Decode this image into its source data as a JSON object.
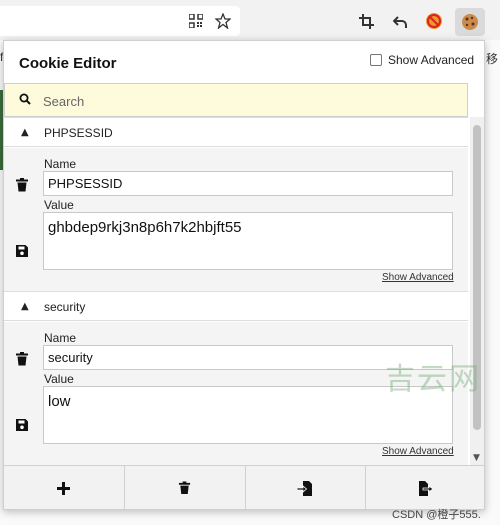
{
  "browser": {
    "icons": [
      "qr-code-icon",
      "bookmark-star-icon",
      "crop-icon",
      "undo-icon",
      "blocker-icon",
      "cookie-icon"
    ],
    "bg_left_char": "f",
    "bg_right_text": "移"
  },
  "popup": {
    "title": "Cookie Editor",
    "show_advanced_label": "Show Advanced",
    "search": {
      "placeholder": "Search"
    },
    "cookies": [
      {
        "name": "PHPSESSID",
        "name_label": "Name",
        "name_value": "PHPSESSID",
        "value_label": "Value",
        "value": "ghbdep9rkj3n8p6h7k2hbjft55",
        "show_advanced_link": "Show Advanced"
      },
      {
        "name": "security",
        "name_label": "Name",
        "name_value": "security",
        "value_label": "Value",
        "value": "low",
        "show_advanced_link": "Show Advanced"
      }
    ],
    "footer_buttons": [
      "add-icon",
      "delete-all-icon",
      "import-icon",
      "export-icon"
    ]
  },
  "watermark": "吉云网",
  "credit": "CSDN @橙子555."
}
